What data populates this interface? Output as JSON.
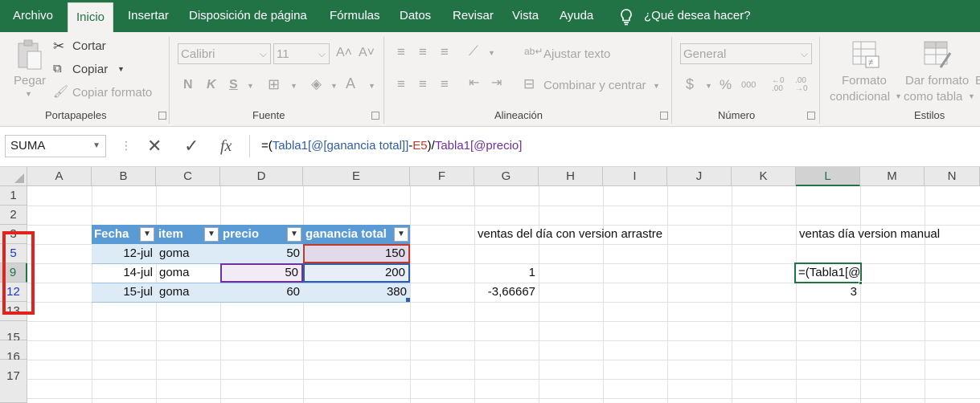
{
  "menu": {
    "tabs": [
      "Archivo",
      "Inicio",
      "Insertar",
      "Disposición de página",
      "Fórmulas",
      "Datos",
      "Revisar",
      "Vista",
      "Ayuda"
    ],
    "tell_me": "¿Qué desea hacer?"
  },
  "ribbon": {
    "clipboard": {
      "paste": "Pegar",
      "cut": "Cortar",
      "copy": "Copiar",
      "format_painter": "Copiar formato",
      "label": "Portapapeles"
    },
    "font": {
      "name": "Calibri",
      "size": "11",
      "bold": "N",
      "italic": "K",
      "underline": "S",
      "label": "Fuente"
    },
    "alignment": {
      "wrap": "Ajustar texto",
      "merge": "Combinar y centrar",
      "label": "Alineación"
    },
    "number": {
      "format": "General",
      "label": "Número",
      "percent": "%",
      "thousands": "000",
      "currency": "$"
    },
    "styles": {
      "conditional_1": "Formato",
      "conditional_2": "condicional",
      "table_1": "Dar formato",
      "table_2": "como tabla",
      "label": "Estilos"
    }
  },
  "formula_bar": {
    "name_box": "SUMA",
    "formula_parts": [
      "=(",
      "Tabla1[@[ganancia total]]",
      "-",
      "E5",
      ")/",
      "Tabla1[@precio]"
    ]
  },
  "sheet": {
    "columns": [
      "A",
      "B",
      "C",
      "D",
      "E",
      "F",
      "G",
      "H",
      "I",
      "J",
      "K",
      "L",
      "M",
      "N"
    ],
    "rows": [
      "1",
      "2",
      "3",
      "5",
      "9",
      "12",
      "13",
      "15",
      "16",
      "17"
    ],
    "table_headers": [
      "Fecha",
      "item",
      "precio",
      "ganancia total"
    ],
    "table_rows": [
      [
        "12-jul",
        "goma",
        "50",
        "150"
      ],
      [
        "14-jul",
        "goma",
        "50",
        "200"
      ],
      [
        "15-jul",
        "goma",
        "60",
        "380"
      ]
    ],
    "g3": "ventas del día con version arrastre",
    "g9": "1",
    "g12": "-3,66667",
    "l3": "ventas día version manual",
    "l9": "=(Tabla1[@",
    "l12": "3"
  }
}
